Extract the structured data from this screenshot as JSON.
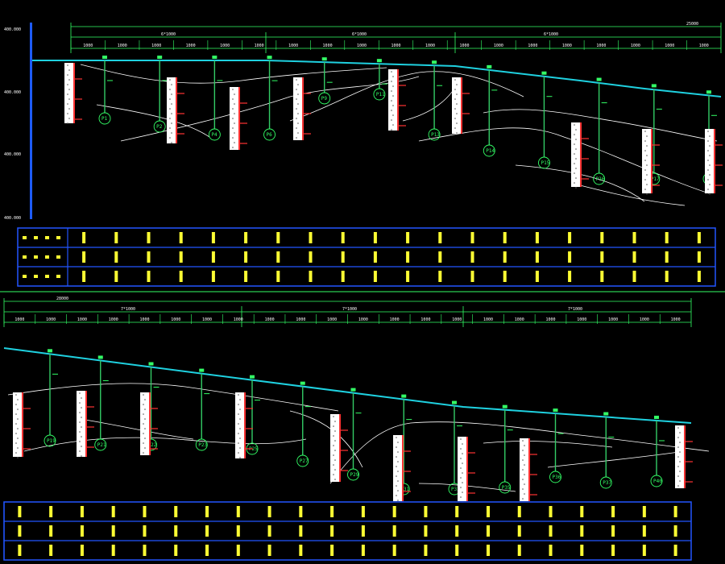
{
  "drawing": {
    "colors": {
      "background": "#000000",
      "axis": "#1e5bff",
      "dim": "#33ff66",
      "ground": "#1fd1e0",
      "pile": "#33cc66",
      "borehole": "#ffffff",
      "marker": "#ff3333",
      "table_frame": "#2255ff",
      "table_text": "#ffff33"
    },
    "elevation_labels": [
      "400.000",
      "400.000",
      "400.000",
      "400.000"
    ],
    "top": {
      "total_dim": "25000",
      "segment_dims": [
        "6*1000",
        "6*1000",
        "6*1000"
      ],
      "spacing_label": "1000",
      "piles": [
        "P1",
        "P2",
        "P4",
        "P6",
        "P9",
        "P11",
        "P13",
        "P14",
        "P15",
        "P16",
        "P17",
        "P18"
      ],
      "table_rows": 3
    },
    "bottom": {
      "total_dim": "28000",
      "segment_dims": [
        "7*1000",
        "7*1000",
        "7*1000"
      ],
      "spacing_label": "1000",
      "piles": [
        "P19",
        "P21",
        "P22",
        "P23",
        "P25",
        "P27",
        "P29",
        "P31",
        "P32",
        "P35",
        "P36",
        "P37",
        "P40"
      ],
      "table_rows": 3
    }
  }
}
